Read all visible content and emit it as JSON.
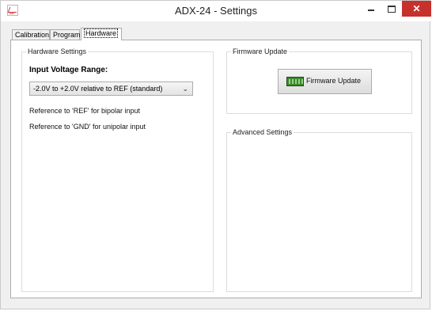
{
  "window": {
    "title": "ADX-24 - Settings",
    "app_icon_text": "AD",
    "controls": [
      "minimize",
      "maximize",
      "close"
    ],
    "close_glyph": "✕"
  },
  "tabs": [
    {
      "label": "Calibration",
      "active": false
    },
    {
      "label": "Program",
      "active": false
    },
    {
      "label": "Hardware",
      "active": true
    }
  ],
  "hardware_settings": {
    "group_title": "Hardware Settings",
    "input_voltage_label": "Input Voltage Range:",
    "selected_range": "-2.0V to +2.0V relative to REF (standard)",
    "note_ref": "Reference to 'REF' for bipolar input",
    "note_gnd": "Reference to 'GND' for unipolar input"
  },
  "firmware_update": {
    "group_title": "Firmware Update",
    "button_label": "Firmware Update",
    "button_icon": "chip-icon"
  },
  "advanced_settings": {
    "group_title": "Advanced Settings"
  },
  "colors": {
    "close_button": "#c7312b",
    "window_bg": "#f0f0f0",
    "chip_green": "#3d8a2c"
  }
}
